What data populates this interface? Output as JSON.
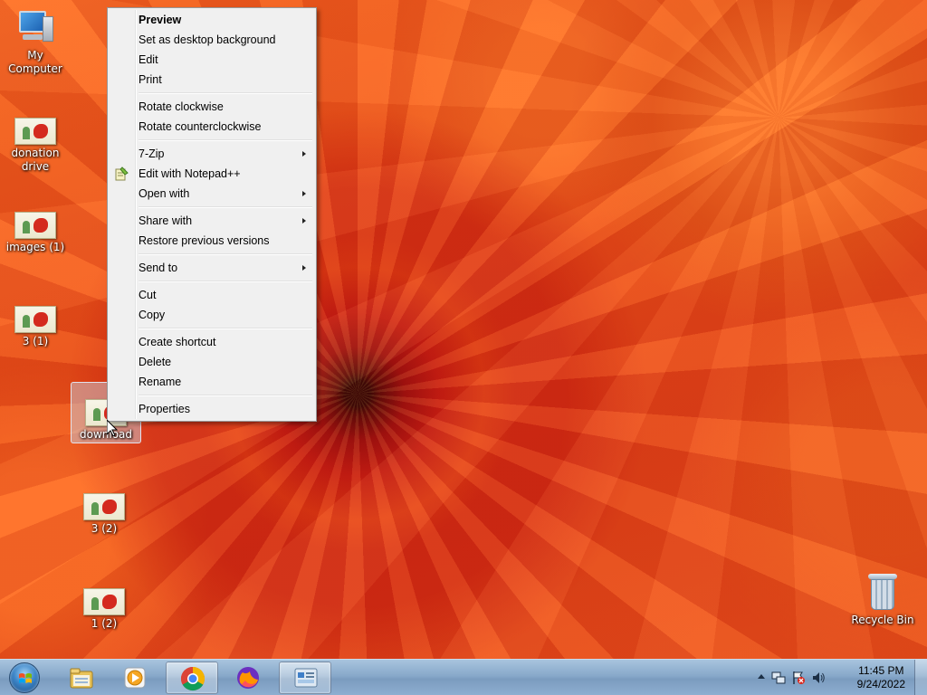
{
  "desktop": {
    "icons": [
      {
        "label": "My Computer"
      },
      {
        "label": "donation drive"
      },
      {
        "label": "images (1)"
      },
      {
        "label": "3 (1)"
      },
      {
        "label": "download"
      },
      {
        "label": "3 (2)"
      },
      {
        "label": "1 (2)"
      },
      {
        "label": "Recycle Bin"
      }
    ]
  },
  "context_menu": {
    "items": [
      {
        "label": "Preview"
      },
      {
        "label": "Set as desktop background"
      },
      {
        "label": "Edit"
      },
      {
        "label": "Print"
      },
      {
        "label": "Rotate clockwise"
      },
      {
        "label": "Rotate counterclockwise"
      },
      {
        "label": "7-Zip"
      },
      {
        "label": "Edit with Notepad++"
      },
      {
        "label": "Open with"
      },
      {
        "label": "Share with"
      },
      {
        "label": "Restore previous versions"
      },
      {
        "label": "Send to"
      },
      {
        "label": "Cut"
      },
      {
        "label": "Copy"
      },
      {
        "label": "Create shortcut"
      },
      {
        "label": "Delete"
      },
      {
        "label": "Rename"
      },
      {
        "label": "Properties"
      }
    ]
  },
  "taskbar": {
    "pinned": [
      {
        "icon": "file-explorer-icon"
      },
      {
        "icon": "media-player-icon"
      },
      {
        "icon": "chrome-icon"
      },
      {
        "icon": "firefox-icon"
      },
      {
        "icon": "control-panel-icon"
      }
    ],
    "clock": {
      "time": "11:45 PM",
      "date": "9/24/2022"
    }
  },
  "colors": {
    "menu_bg": "#f0f0f0",
    "taskbar": "#88a9ca",
    "wallpaper_accent": "#e8461a"
  }
}
